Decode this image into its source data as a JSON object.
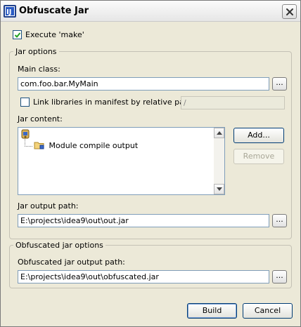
{
  "window": {
    "title": "Obfuscate Jar",
    "close_icon": "close-icon"
  },
  "execute_make": {
    "label": "Execute 'make'",
    "checked": true
  },
  "jar_options": {
    "title": "Jar options",
    "main_class_label": "Main class:",
    "main_class_value": "com.foo.bar.MyMain",
    "browse_label": "...",
    "link_libraries": {
      "label": "Link libraries in manifest by relative path:",
      "checked": false,
      "value": "/"
    },
    "jar_content_label": "Jar content:",
    "tree": {
      "child": "Module compile output"
    },
    "add_label": "Add...",
    "remove_label": "Remove",
    "output_path_label": "Jar output path:",
    "output_path_value": "E:\\projects\\idea9\\out\\out.jar"
  },
  "obfuscated_options": {
    "title": "Obfuscated jar options",
    "output_path_label": "Obfuscated jar output path:",
    "output_path_value": "E:\\projects\\idea9\\out\\obfuscated.jar"
  },
  "footer": {
    "build_label": "Build",
    "cancel_label": "Cancel"
  },
  "colors": {
    "dialog_bg": "#ece9d8",
    "field_border": "#7f9db9",
    "button_border": "#003c74"
  }
}
